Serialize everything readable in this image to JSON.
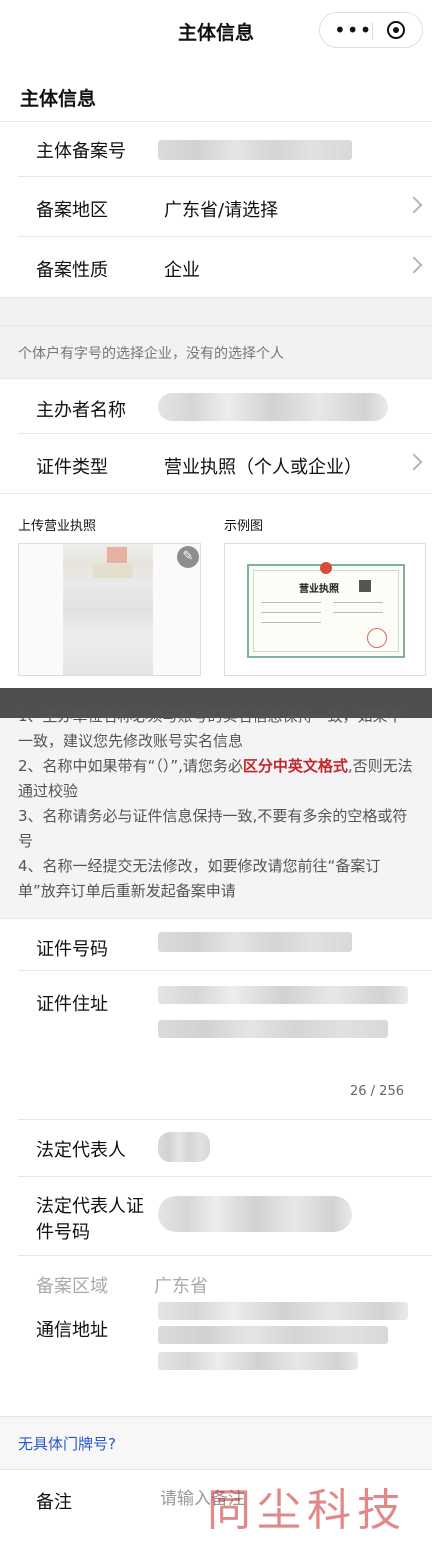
{
  "header": {
    "title": "主体信息",
    "more_icon": "more-dots-icon",
    "close_icon": "target-circle-icon"
  },
  "section_title": "主体信息",
  "fields": {
    "record_no": {
      "label": "主体备案号"
    },
    "region": {
      "label": "备案地区",
      "value": "广东省/请选择"
    },
    "nature": {
      "label": "备案性质",
      "value": "企业"
    },
    "hint": "个体户有字号的选择企业，没有的选择个人",
    "sponsor_name": {
      "label": "主办者名称"
    },
    "cert_type": {
      "label": "证件类型",
      "value": "营业执照（个人或企业）"
    }
  },
  "upload": {
    "upload_title": "上传营业执照",
    "sample_title": "示例图",
    "sample_license_title": "营业执照"
  },
  "notice": {
    "line1": "1、主办单位名称必须与账号的实名信息保持一致，如果不一致，建议您先修改账号实名信息",
    "line2_a": "2、名称中如果带有“（）”,请您务必",
    "line2_red": "区分中英文格式",
    "line2_b": ",否则无法通过校验",
    "line3": "3、名称请务必与证件信息保持一致,不要有多余的空格或符号",
    "line4": "4、名称一经提交无法修改，如要修改请您前往“备案订单”放弃订单后重新发起备案申请"
  },
  "more_fields": {
    "cert_no": {
      "label": "证件号码"
    },
    "cert_address": {
      "label": "证件住址",
      "counter": "26 / 256"
    },
    "legal_rep": {
      "label": "法定代表人"
    },
    "legal_rep_id_line1": "法定代表人证",
    "legal_rep_id_line2": "件号码",
    "record_area": {
      "label": "备案区域",
      "value": "广东省"
    },
    "mail_address": {
      "label": "通信地址"
    },
    "no_house_no": "无具体门牌号?",
    "remark": {
      "label": "备注",
      "placeholder": "请输入备注"
    }
  },
  "watermark": "同尘科技",
  "colors": {
    "accent_red": "#c0282d",
    "link_blue": "#2a57c8",
    "gray_band": "#f2f2f2"
  }
}
